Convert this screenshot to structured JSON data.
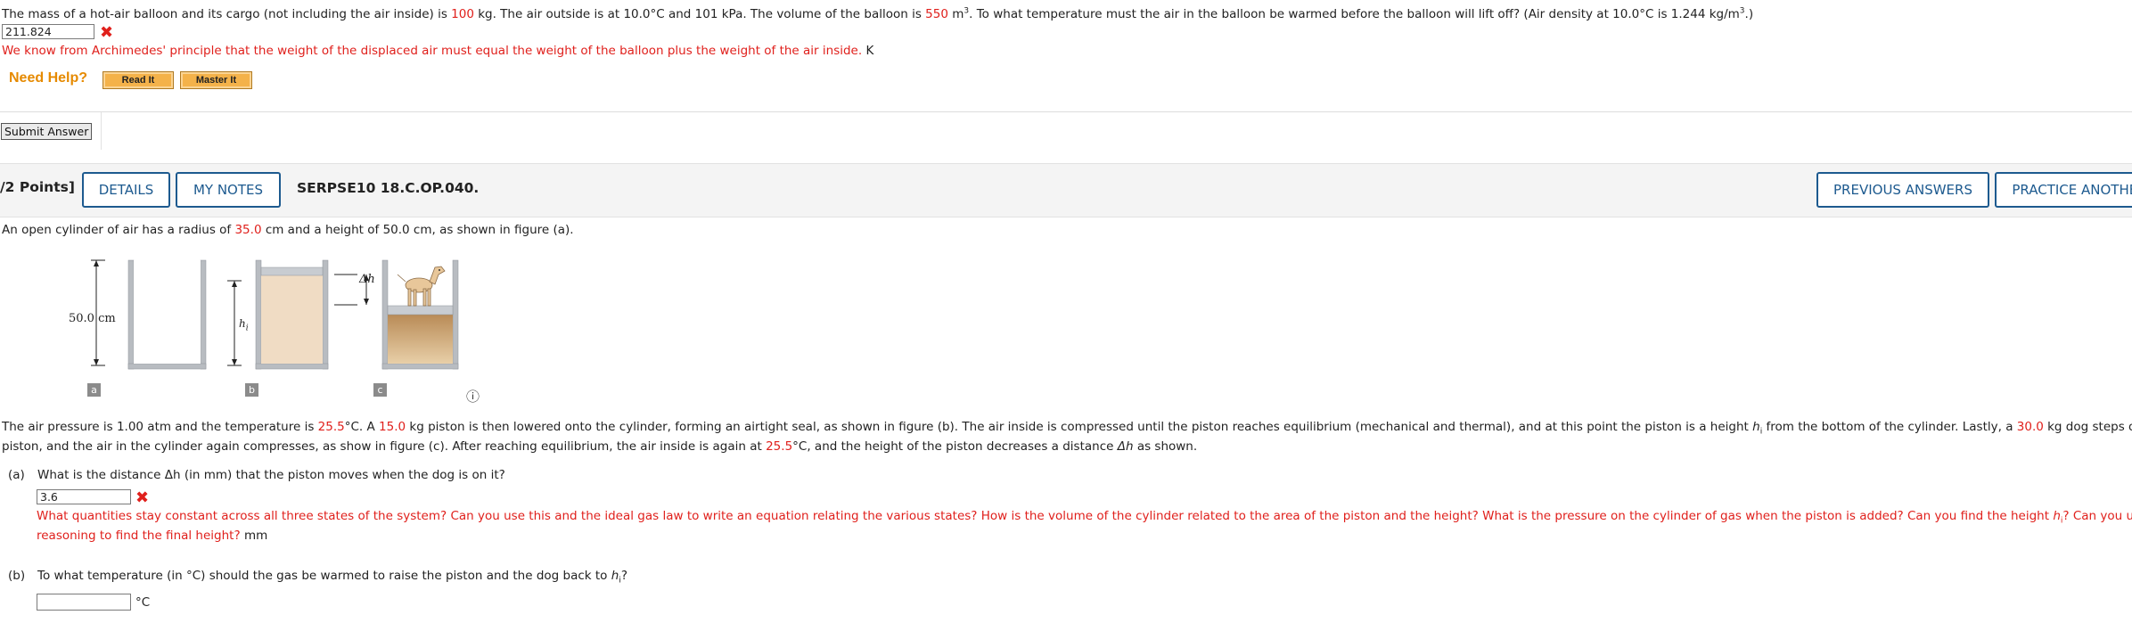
{
  "q1": {
    "text_a": "The mass of a hot-air balloon and its cargo (not including the air inside) is ",
    "mass": "100",
    "text_b": " kg. The air outside is at 10.0°C and 101 kPa. The volume of the balloon is ",
    "volume": "550",
    "text_c": " m",
    "text_d": ". To what temperature must the air in the balloon be warmed before the balloon will lift off? (Air density at 10.0°C is 1.244 kg/m",
    "text_e": ".)",
    "answer": "211.824",
    "feedback": "We know from Archimedes' principle that the weight of the displaced air must equal the weight of the balloon plus the weight of the air inside.",
    "unit": "K",
    "need_help": "Need Help?",
    "read_it": "Read It",
    "master_it": "Master It",
    "submit": "Submit Answer"
  },
  "header": {
    "points": "/2 Points]",
    "details": "DETAILS",
    "my_notes": "MY NOTES",
    "code": "SERPSE10 18.C.OP.040.",
    "previous_answers": "PREVIOUS ANSWERS",
    "practice_another": "PRACTICE ANOTHER"
  },
  "q2": {
    "intro_a": "An open cylinder of air has a radius of ",
    "radius": "35.0",
    "intro_b": " cm and a height of 50.0 cm, as shown in figure (a).",
    "figure": {
      "height_label": "50.0 cm",
      "h_label": "h",
      "h_sub": "i",
      "dh_label": "Δh",
      "labels": [
        "a",
        "b",
        "c"
      ],
      "info_icon": "ⓘ"
    },
    "para": {
      "p1": "The air pressure is 1.00 atm and the temperature is ",
      "temp1": "25.5",
      "p2": "°C. A ",
      "piston_mass": "15.0",
      "p3": " kg piston is then lowered onto the cylinder, forming an airtight seal, as shown in figure (b). The air inside is compressed until the piston reaches equilibrium (mechanical and thermal), and at this point the piston is a height ",
      "h": "h",
      "h_sub": "i",
      "p4": " from the bottom of the cylinder. Lastly, a ",
      "dog_mass": "30.0",
      "p5": " kg dog steps onto the",
      "line2_a": "piston, and the air in the cylinder again compresses, as show in figure (c). After reaching equilibrium, the air inside is again at ",
      "temp2": "25.5",
      "line2_b": "°C, and the height of the piston decreases a distance ",
      "dh": "Δh",
      "line2_c": " as shown."
    },
    "part_a": {
      "label": "(a)",
      "question": "What is the distance Δh (in mm) that the piston moves when the dog is on it?",
      "answer": "3.6",
      "feedback1_a": "What quantities stay constant across all three states of the system? Can you use this and the ideal gas law to write an equation relating the various states? How is the volume of the cylinder related to the area of the piston and the height? What is the pressure on the cylinder of gas when the piston is added? Can you find the height ",
      "feedback1_h": "h",
      "feedback1_sub": "i",
      "feedback1_b": "? Can you use similar",
      "feedback2": "reasoning to find the final height?",
      "unit": "mm"
    },
    "part_b": {
      "label": "(b)",
      "question_a": "To what temperature (in °C) should the gas be warmed to raise the piston and the dog back to ",
      "h": "h",
      "h_sub": "i",
      "question_b": "?",
      "answer": "",
      "unit": "°C"
    }
  },
  "colors": {
    "accent_blue": "#1d5a8f",
    "error_red": "#e0201c",
    "help_orange": "#e68a00"
  }
}
